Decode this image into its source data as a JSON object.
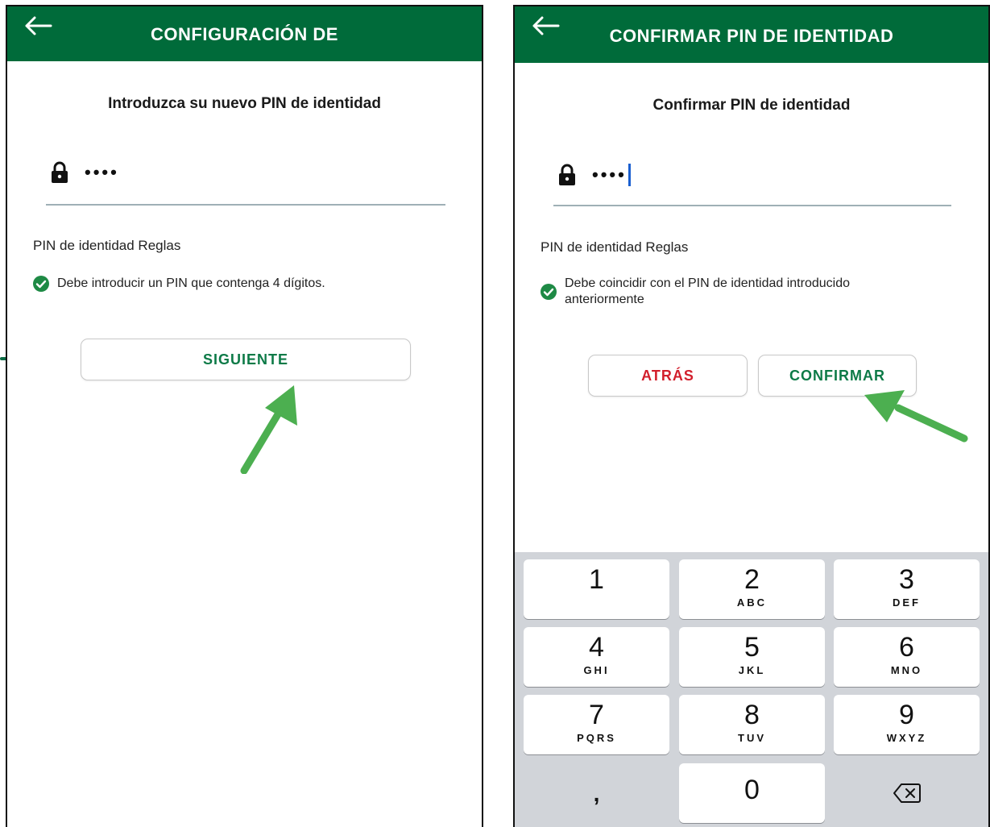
{
  "left_screen": {
    "title": "CONFIGURACIÓN DE",
    "heading": "Introduzca su nuevo PIN de identidad",
    "pin_value": "••••",
    "rules_title": "PIN de identidad Reglas",
    "rule": "Debe introducir un PIN que contenga 4 dígitos.",
    "next_button": "SIGUIENTE"
  },
  "right_screen": {
    "title": "CONFIRMAR PIN DE IDENTIDAD",
    "heading": "Confirmar PIN de identidad",
    "pin_value": "••••",
    "rules_title": "PIN de identidad Reglas",
    "rule_line1": "Debe coincidir con el PIN de identidad introducido",
    "rule_line2": "anteriormente",
    "back_button": "ATRÁS",
    "confirm_button": "CONFIRMAR"
  },
  "keypad": {
    "keys": [
      {
        "num": "1",
        "letters": ""
      },
      {
        "num": "2",
        "letters": "ABC"
      },
      {
        "num": "3",
        "letters": "DEF"
      },
      {
        "num": "4",
        "letters": "GHI"
      },
      {
        "num": "5",
        "letters": "JKL"
      },
      {
        "num": "6",
        "letters": "MNO"
      },
      {
        "num": "7",
        "letters": "PQRS"
      },
      {
        "num": "8",
        "letters": "TUV"
      },
      {
        "num": "9",
        "letters": "WXYZ"
      }
    ],
    "comma": ",",
    "zero": "0",
    "backspace_icon": "backspace-icon"
  },
  "colors": {
    "appbar": "#006b3a",
    "accent_green": "#0d7a47",
    "danger_red": "#d21f2c",
    "annotation_arrow": "#4caf50",
    "caret": "#1a5fd0"
  },
  "icons": [
    "back-arrow-icon",
    "lock-icon",
    "check-circle-icon",
    "backspace-icon",
    "annotation-arrow"
  ]
}
